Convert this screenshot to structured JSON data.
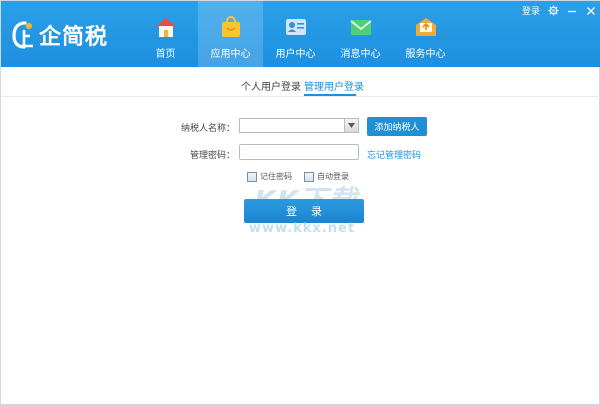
{
  "app": {
    "logo_text": "企简税"
  },
  "nav": {
    "items": [
      {
        "label": "首页",
        "icon": "home-icon"
      },
      {
        "label": "应用中心",
        "icon": "bag-icon"
      },
      {
        "label": "用户中心",
        "icon": "user-card-icon"
      },
      {
        "label": "消息中心",
        "icon": "mail-icon"
      },
      {
        "label": "服务中心",
        "icon": "service-mail-icon"
      }
    ],
    "active_index": 1
  },
  "window": {
    "login_label": "登录"
  },
  "tabs": [
    {
      "label": "个人用户登录"
    },
    {
      "label": "管理用户登录"
    }
  ],
  "form": {
    "taxpayer_label": "纳税人名称：",
    "taxpayer_value": "",
    "add_button": "添加纳税人",
    "password_label": "管理密码：",
    "password_value": "",
    "forgot_link": "忘记管理密码",
    "remember_label": "记住密码",
    "auto_login_label": "自动登录",
    "login_button": "登录"
  },
  "watermark": {
    "big": "KK下载",
    "small": "www.kkx.net"
  },
  "colors": {
    "header": "#1e8fdf",
    "accent": "#1f8fd6"
  }
}
